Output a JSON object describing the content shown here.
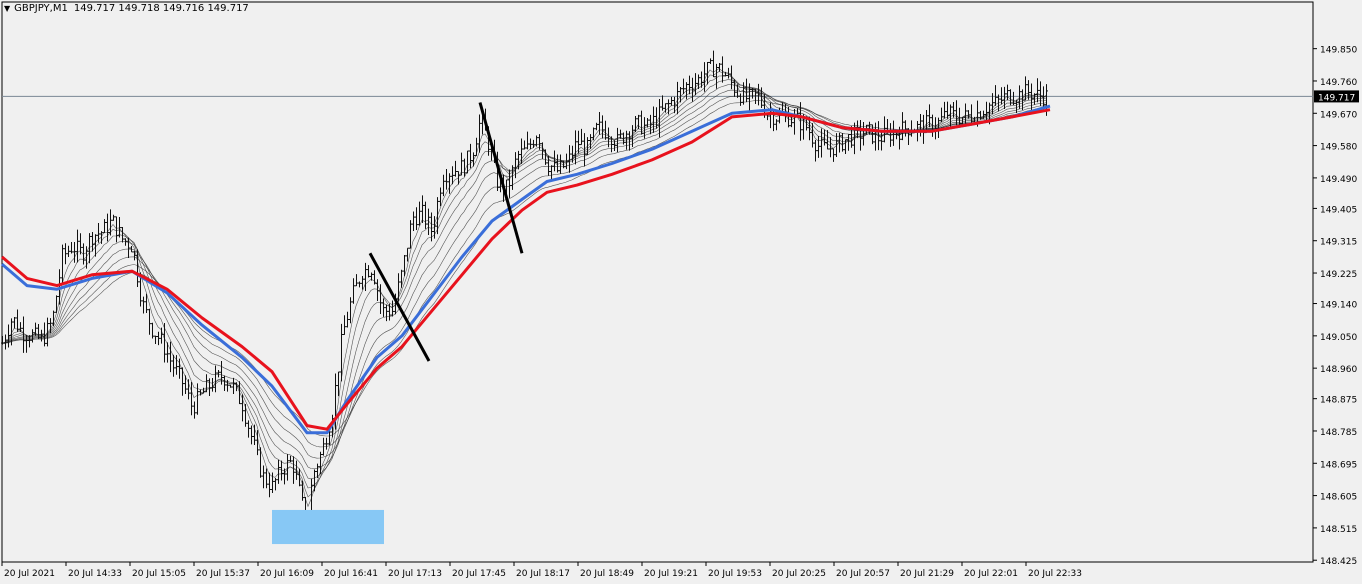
{
  "header": {
    "symbol": "GBPJPY,M1",
    "ohlc": "149.717 149.718 149.716 149.717"
  },
  "chart_data": {
    "type": "candlestick",
    "symbol": "GBPJPY",
    "timeframe": "M1",
    "current_price": 149.717,
    "ylim": [
      148.42,
      149.98
    ],
    "y_ticks": [
      "149.850",
      "149.760",
      "149.670",
      "149.580",
      "149.490",
      "149.405",
      "149.315",
      "149.225",
      "149.140",
      "149.050",
      "148.960",
      "148.875",
      "148.785",
      "148.695",
      "148.605",
      "148.515",
      "148.425"
    ],
    "x_ticks": [
      "20 Jul 2021",
      "20 Jul 14:33",
      "20 Jul 15:05",
      "20 Jul 15:37",
      "20 Jul 16:09",
      "20 Jul 16:41",
      "20 Jul 17:13",
      "20 Jul 17:45",
      "20 Jul 18:17",
      "20 Jul 18:49",
      "20 Jul 19:21",
      "20 Jul 19:53",
      "20 Jul 20:25",
      "20 Jul 20:57",
      "20 Jul 21:29",
      "20 Jul 22:01",
      "20 Jul 22:33"
    ],
    "price_path": [
      [
        0,
        149.03
      ],
      [
        10,
        149.1
      ],
      [
        20,
        149.06
      ],
      [
        30,
        149.05
      ],
      [
        40,
        149.04
      ],
      [
        50,
        149.09
      ],
      [
        60,
        149.27
      ],
      [
        70,
        149.3
      ],
      [
        80,
        149.28
      ],
      [
        90,
        149.33
      ],
      [
        100,
        149.34
      ],
      [
        110,
        149.37
      ],
      [
        120,
        149.32
      ],
      [
        130,
        149.3
      ],
      [
        140,
        149.14
      ],
      [
        150,
        149.07
      ],
      [
        160,
        149.03
      ],
      [
        170,
        148.97
      ],
      [
        180,
        148.92
      ],
      [
        190,
        148.85
      ],
      [
        200,
        148.89
      ],
      [
        210,
        148.92
      ],
      [
        220,
        148.94
      ],
      [
        230,
        148.91
      ],
      [
        240,
        148.86
      ],
      [
        250,
        148.76
      ],
      [
        260,
        148.66
      ],
      [
        270,
        148.63
      ],
      [
        280,
        148.68
      ],
      [
        290,
        148.7
      ],
      [
        300,
        148.58
      ],
      [
        305,
        148.5
      ],
      [
        310,
        148.66
      ],
      [
        320,
        148.73
      ],
      [
        330,
        148.84
      ],
      [
        340,
        149.05
      ],
      [
        350,
        149.16
      ],
      [
        360,
        149.23
      ],
      [
        370,
        149.24
      ],
      [
        380,
        149.12
      ],
      [
        390,
        149.12
      ],
      [
        400,
        149.23
      ],
      [
        410,
        149.38
      ],
      [
        420,
        149.39
      ],
      [
        430,
        149.34
      ],
      [
        440,
        149.5
      ],
      [
        450,
        149.51
      ],
      [
        460,
        149.52
      ],
      [
        470,
        149.56
      ],
      [
        478,
        149.65
      ],
      [
        485,
        149.6
      ],
      [
        495,
        149.48
      ],
      [
        505,
        149.46
      ],
      [
        515,
        149.55
      ],
      [
        525,
        149.57
      ],
      [
        535,
        149.62
      ],
      [
        545,
        149.53
      ],
      [
        555,
        149.51
      ],
      [
        565,
        149.53
      ],
      [
        575,
        149.59
      ],
      [
        585,
        149.57
      ],
      [
        595,
        149.63
      ],
      [
        605,
        149.62
      ],
      [
        615,
        149.59
      ],
      [
        625,
        149.62
      ],
      [
        635,
        149.64
      ],
      [
        645,
        149.63
      ],
      [
        655,
        149.66
      ],
      [
        665,
        149.69
      ],
      [
        675,
        149.72
      ],
      [
        685,
        149.75
      ],
      [
        695,
        149.76
      ],
      [
        705,
        149.79
      ],
      [
        715,
        149.8
      ],
      [
        725,
        149.77
      ],
      [
        735,
        149.73
      ],
      [
        745,
        149.71
      ],
      [
        755,
        149.72
      ],
      [
        765,
        149.67
      ],
      [
        775,
        149.66
      ],
      [
        785,
        149.66
      ],
      [
        795,
        149.65
      ],
      [
        805,
        149.63
      ],
      [
        815,
        149.58
      ],
      [
        825,
        149.57
      ],
      [
        835,
        149.58
      ],
      [
        845,
        149.6
      ],
      [
        855,
        149.61
      ],
      [
        865,
        149.62
      ],
      [
        875,
        149.6
      ],
      [
        885,
        149.61
      ],
      [
        895,
        149.62
      ],
      [
        905,
        149.63
      ],
      [
        915,
        149.63
      ],
      [
        925,
        149.64
      ],
      [
        935,
        149.64
      ],
      [
        945,
        149.67
      ],
      [
        955,
        149.66
      ],
      [
        965,
        149.66
      ],
      [
        975,
        149.67
      ],
      [
        985,
        149.69
      ],
      [
        995,
        149.7
      ],
      [
        1005,
        149.72
      ],
      [
        1015,
        149.72
      ],
      [
        1025,
        149.73
      ],
      [
        1035,
        149.72
      ],
      [
        1045,
        149.717
      ]
    ],
    "series": [
      {
        "name": "",
        "color": "#e8121d",
        "values": [
          [
            0,
            149.27
          ],
          [
            25,
            149.21
          ],
          [
            55,
            149.19
          ],
          [
            90,
            149.22
          ],
          [
            130,
            149.23
          ],
          [
            165,
            149.18
          ],
          [
            200,
            149.1
          ],
          [
            240,
            149.02
          ],
          [
            270,
            148.95
          ],
          [
            305,
            148.8
          ],
          [
            325,
            148.79
          ],
          [
            345,
            148.86
          ],
          [
            375,
            148.96
          ],
          [
            400,
            149.02
          ],
          [
            430,
            149.12
          ],
          [
            460,
            149.22
          ],
          [
            490,
            149.32
          ],
          [
            520,
            149.4
          ],
          [
            545,
            149.45
          ],
          [
            575,
            149.47
          ],
          [
            610,
            149.5
          ],
          [
            650,
            149.54
          ],
          [
            690,
            149.59
          ],
          [
            730,
            149.66
          ],
          [
            770,
            149.67
          ],
          [
            800,
            149.66
          ],
          [
            840,
            149.63
          ],
          [
            880,
            149.62
          ],
          [
            930,
            149.62
          ],
          [
            970,
            149.64
          ],
          [
            1010,
            149.66
          ],
          [
            1048,
            149.68
          ]
        ]
      },
      {
        "name": "",
        "color": "#3a6ed9",
        "values": [
          [
            0,
            149.25
          ],
          [
            25,
            149.19
          ],
          [
            55,
            149.18
          ],
          [
            90,
            149.21
          ],
          [
            130,
            149.23
          ],
          [
            165,
            149.17
          ],
          [
            200,
            149.08
          ],
          [
            240,
            148.99
          ],
          [
            270,
            148.91
          ],
          [
            305,
            148.78
          ],
          [
            325,
            148.78
          ],
          [
            345,
            148.87
          ],
          [
            375,
            148.99
          ],
          [
            400,
            149.05
          ],
          [
            430,
            149.16
          ],
          [
            460,
            149.27
          ],
          [
            490,
            149.37
          ],
          [
            520,
            149.43
          ],
          [
            545,
            149.48
          ],
          [
            575,
            149.5
          ],
          [
            610,
            149.53
          ],
          [
            650,
            149.57
          ],
          [
            690,
            149.62
          ],
          [
            730,
            149.67
          ],
          [
            770,
            149.68
          ],
          [
            800,
            149.66
          ],
          [
            840,
            149.63
          ],
          [
            880,
            149.62
          ],
          [
            930,
            149.62
          ],
          [
            970,
            149.64
          ],
          [
            1010,
            149.66
          ],
          [
            1048,
            149.69
          ]
        ]
      }
    ],
    "annotations": {
      "trend_lines": [
        {
          "from": [
            368,
            149.28
          ],
          "to": [
            427,
            148.98
          ]
        },
        {
          "from": [
            478,
            149.7
          ],
          "to": [
            520,
            149.28
          ]
        }
      ],
      "zone": {
        "x": [
          270,
          382
        ],
        "y": [
          148.47,
          148.565
        ],
        "color": "#87c8f5"
      }
    }
  }
}
